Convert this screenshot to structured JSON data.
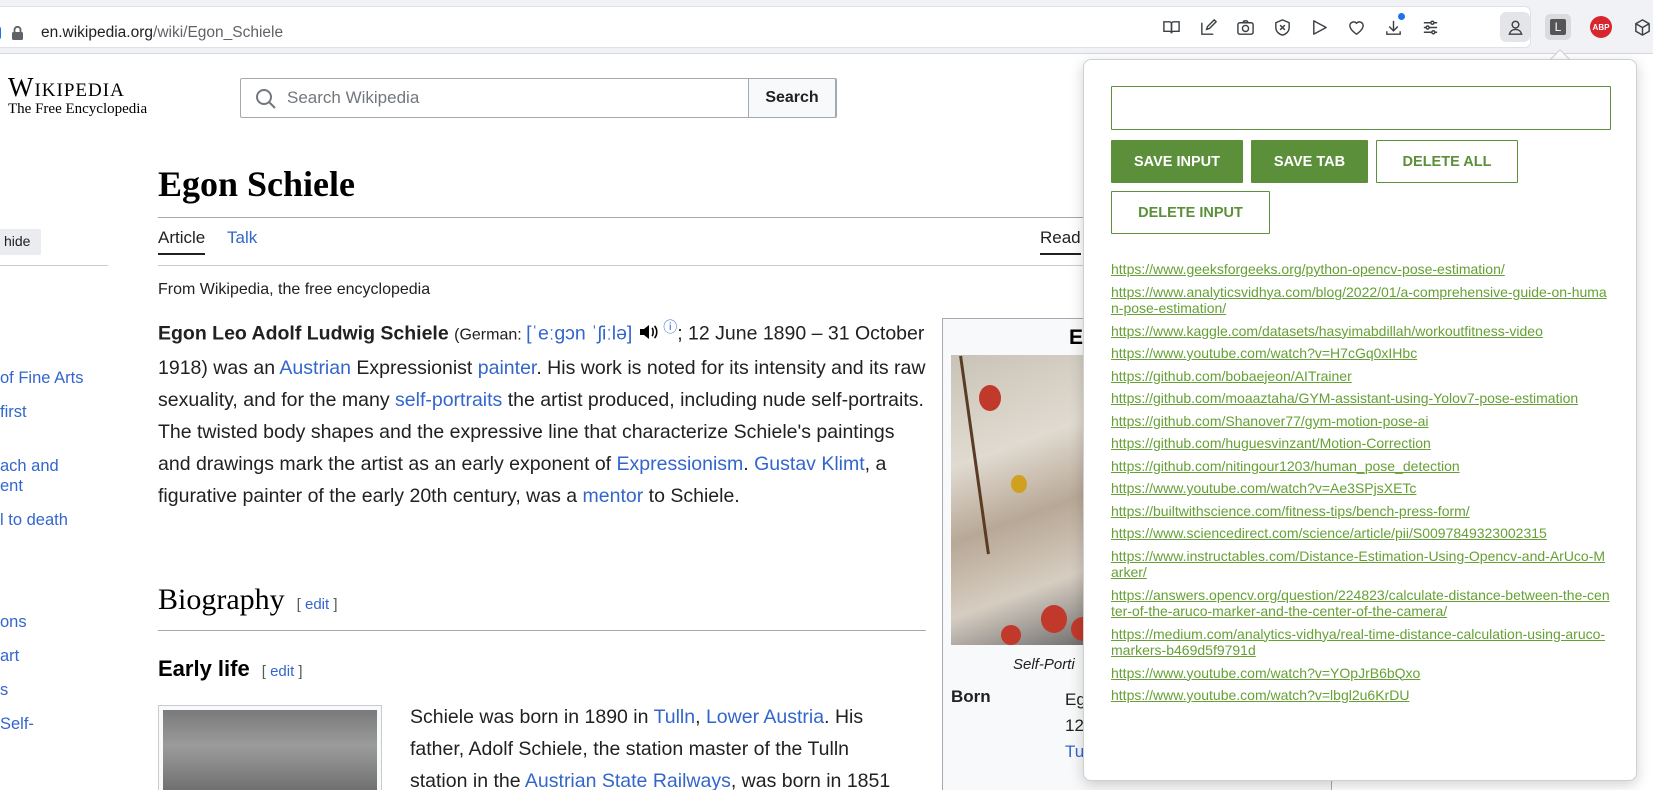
{
  "browser": {
    "url_host": "en.wikipedia.org",
    "url_path": "/wiki/Egon_Schiele",
    "toolbar_icons": [
      "reader-mode-icon",
      "edit-icon",
      "camera-icon",
      "shield-icon",
      "play-icon",
      "heart-icon",
      "download-icon",
      "settings-icon",
      "profile-icon"
    ],
    "extensions": {
      "l_label": "L",
      "abp_label": "ABP"
    }
  },
  "wiki": {
    "logo_title": "Wikipedia",
    "logo_tagline": "The Free Encyclopedia",
    "search_placeholder": "Search Wikipedia",
    "search_button": "Search",
    "toc_hide": "hide",
    "toc_items": [
      "of Fine Arts",
      "first",
      "ach and",
      "ent",
      "l to death",
      "ons",
      "art",
      "s",
      "Self-"
    ],
    "page_title": "Egon Schiele",
    "tab_article": "Article",
    "tab_talk": "Talk",
    "tab_read": "Read",
    "from": "From Wikipedia, the free encyclopedia",
    "lead": {
      "name": "Egon Leo Adolf Ludwig Schiele",
      "german": "(German: ",
      "ipa": "[ˈeːɡɔn ˈʃiːlə]",
      "dates": "; 12 June 1890 – 31 October 1918) was an ",
      "austrian": "Austrian",
      "t1": " Expressionist ",
      "painter": "painter",
      "t2": ". His work is noted for its intensity and its raw sexuality, and for the many ",
      "self_portraits": "self-portraits",
      "t3": " the artist produced, including nude self-portraits. The twisted body shapes and the expressive line that characterize Schiele's paintings and drawings mark the artist as an early exponent of ",
      "expressionism": "Expressionism",
      "t4": ". ",
      "klimt": "Gustav Klimt",
      "t5": ", a figurative painter of the early 20th century, was a ",
      "mentor": "mentor",
      "t6": " to Schiele."
    },
    "h2_biography": "Biography",
    "h3_early_life": "Early life",
    "edit": "edit",
    "para": {
      "t1": "Schiele was born in 1890 in ",
      "tulln": "Tulln",
      "comma": ", ",
      "lower_austria": "Lower Austria",
      "t2": ". His father, Adolf Schiele, the station master of the Tulln station in the ",
      "railways": "Austrian State Railways",
      "t3": ", was born in 1851"
    },
    "infobox": {
      "title_fragment": "E",
      "caption": "Self-Porti",
      "born_label": "Born",
      "born_line1": "Eg",
      "born_line2": "12",
      "born_line3": "Tu"
    }
  },
  "popup": {
    "input_value": "",
    "buttons": {
      "save_input": "SAVE INPUT",
      "save_tab": "SAVE TAB",
      "delete_all": "DELETE ALL",
      "delete_input": "DELETE INPUT"
    },
    "links": [
      "https://www.geeksforgeeks.org/python-opencv-pose-estimation/",
      "https://www.analyticsvidhya.com/blog/2022/01/a-comprehensive-guide-on-human-pose-estimation/",
      "https://www.kaggle.com/datasets/hasyimabdillah/workoutfitness-video",
      "https://www.youtube.com/watch?v=H7cGq0xIHbc",
      "https://github.com/bobaejeon/AITrainer",
      "https://github.com/moaaztaha/GYM-assistant-using-Yolov7-pose-estimation",
      "https://github.com/Shanover77/gym-motion-pose-ai",
      "https://github.com/huguesvinzant/Motion-Correction",
      "https://github.com/nitingour1203/human_pose_detection",
      "https://www.youtube.com/watch?v=Ae3SPjsXETc",
      "https://builtwithscience.com/fitness-tips/bench-press-form/",
      "https://www.sciencedirect.com/science/article/pii/S0097849323002315",
      "https://www.instructables.com/Distance-Estimation-Using-Opencv-and-ArUco-Marker/",
      "https://answers.opencv.org/question/224823/calculate-distance-between-the-center-of-the-aruco-marker-and-the-center-of-the-camera/",
      "https://medium.com/analytics-vidhya/real-time-distance-calculation-using-aruco-markers-b469d5f9791d",
      "https://www.youtube.com/watch?v=YOpJrB6bQxo",
      "https://www.youtube.com/watch?v=lbgl2u6KrDU"
    ]
  }
}
